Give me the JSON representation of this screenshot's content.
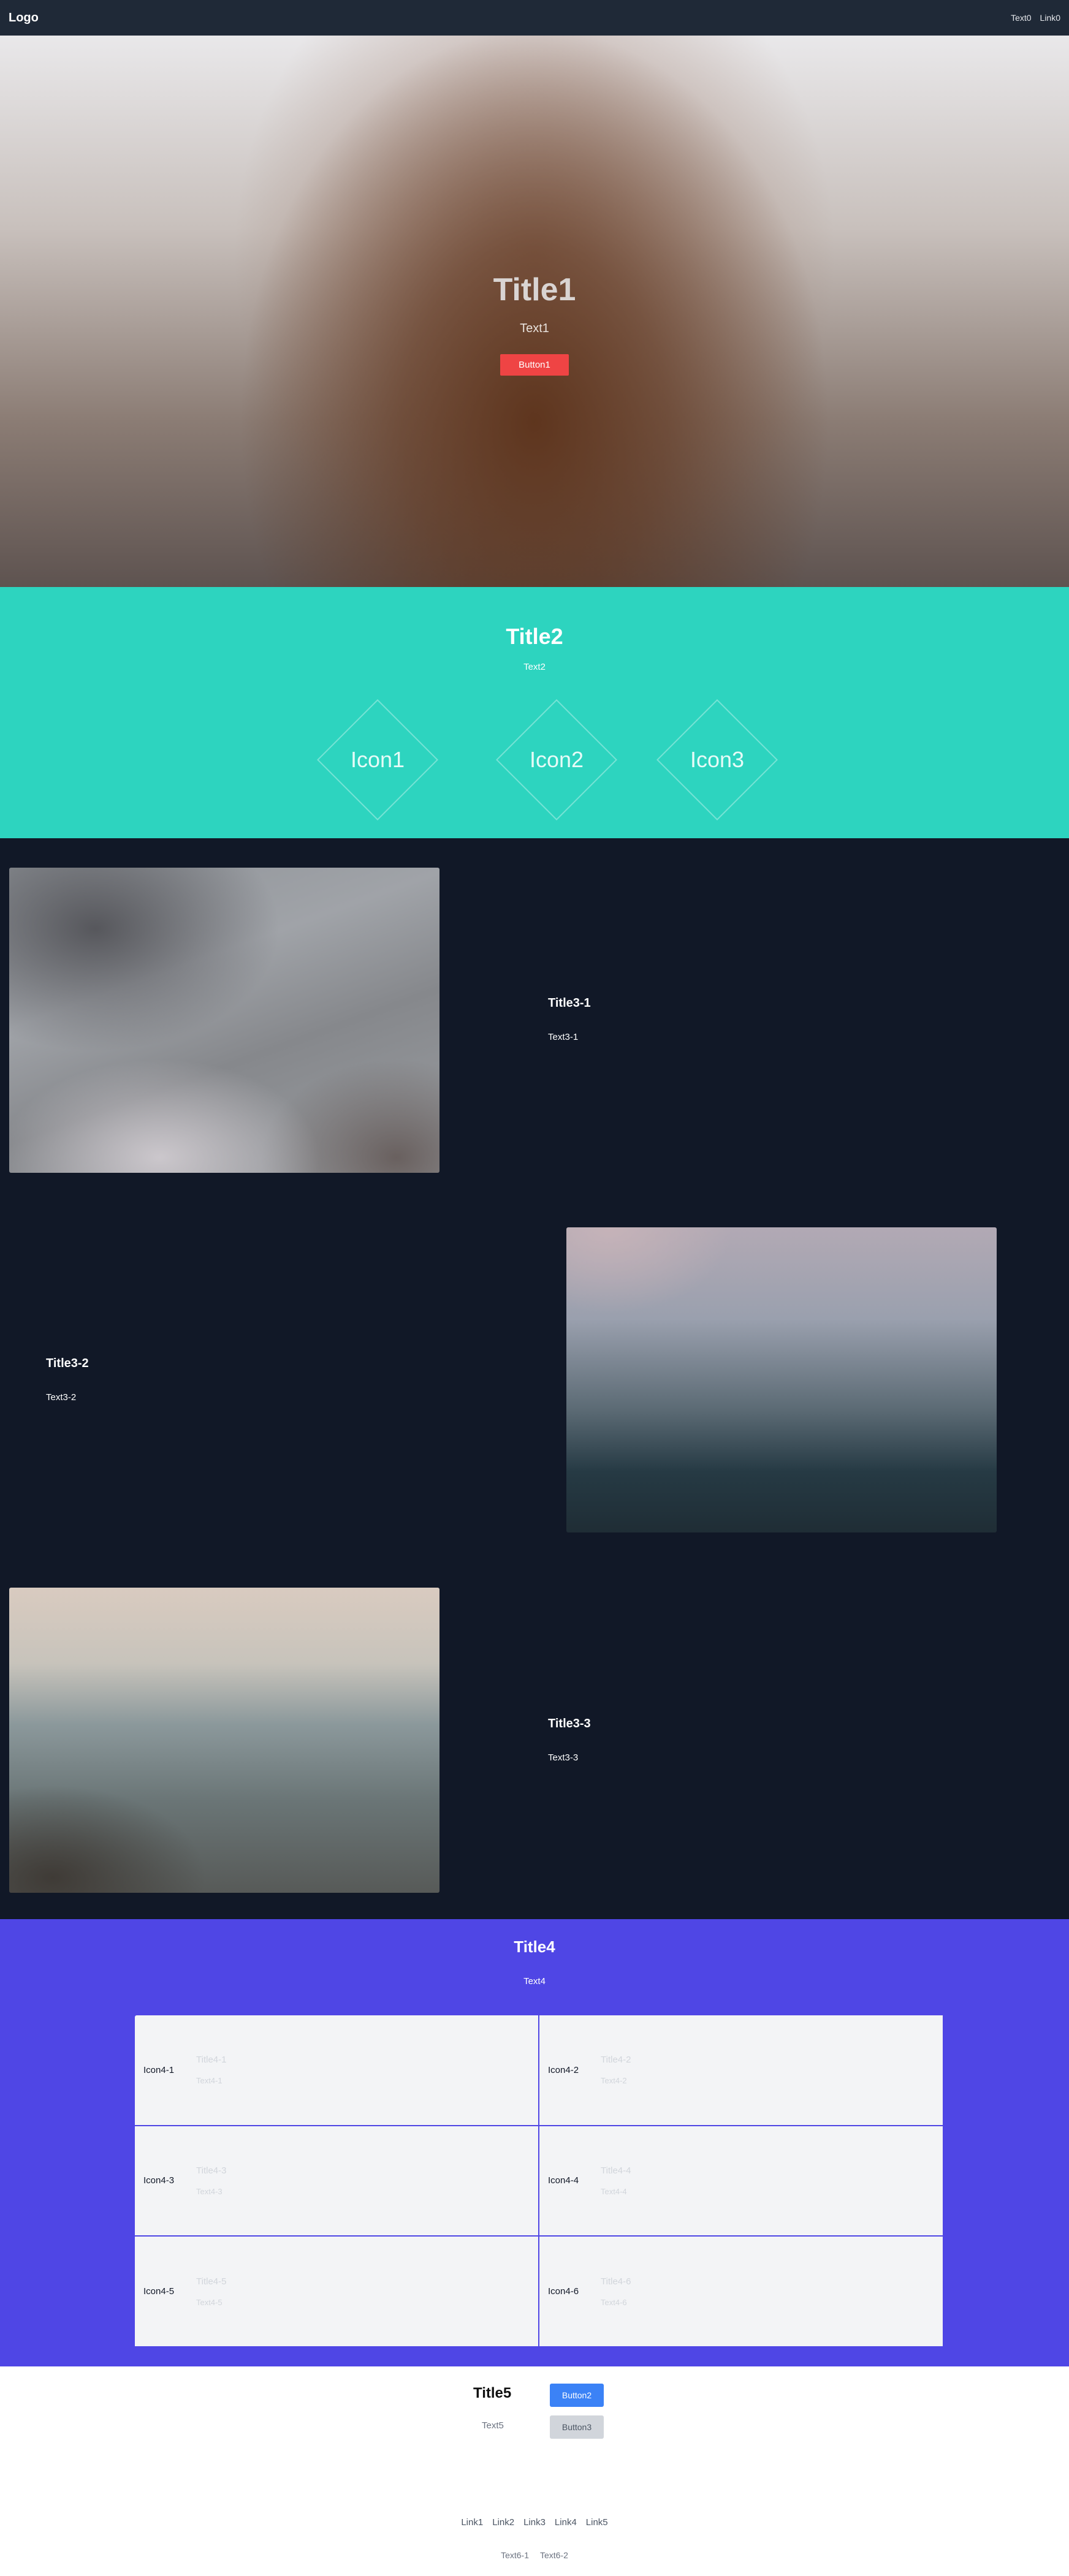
{
  "nav": {
    "logo": "Logo",
    "text": "Text0",
    "link": "Link0"
  },
  "hero": {
    "title": "Title1",
    "text": "Text1",
    "button": "Button1"
  },
  "section2": {
    "title": "Title2",
    "text": "Text2",
    "icons": [
      "Icon1",
      "Icon2",
      "Icon3"
    ]
  },
  "section3": {
    "items": [
      {
        "title": "Title3-1",
        "text": "Text3-1"
      },
      {
        "title": "Title3-2",
        "text": "Text3-2"
      },
      {
        "title": "Title3-3",
        "text": "Text3-3"
      }
    ]
  },
  "section4": {
    "title": "Title4",
    "text": "Text4",
    "cards": [
      {
        "icon": "Icon4-1",
        "title": "Title4-1",
        "text": "Text4-1"
      },
      {
        "icon": "Icon4-2",
        "title": "Title4-2",
        "text": "Text4-2"
      },
      {
        "icon": "Icon4-3",
        "title": "Title4-3",
        "text": "Text4-3"
      },
      {
        "icon": "Icon4-4",
        "title": "Title4-4",
        "text": "Text4-4"
      },
      {
        "icon": "Icon4-5",
        "title": "Title4-5",
        "text": "Text4-5"
      },
      {
        "icon": "Icon4-6",
        "title": "Title4-6",
        "text": "Text4-6"
      }
    ]
  },
  "section5": {
    "title": "Title5",
    "text": "Text5",
    "button_primary": "Button2",
    "button_secondary": "Button3"
  },
  "footer": {
    "links": [
      "Link1",
      "Link2",
      "Link3",
      "Link4",
      "Link5"
    ],
    "texts": [
      "Text6-1",
      "Text6-2"
    ]
  },
  "colors": {
    "nav_bg": "#1f2937",
    "accent_red": "#ef4444",
    "teal": "#2dd4bf",
    "dark": "#111827",
    "indigo": "#4f46e5",
    "blue": "#3b82f6"
  }
}
